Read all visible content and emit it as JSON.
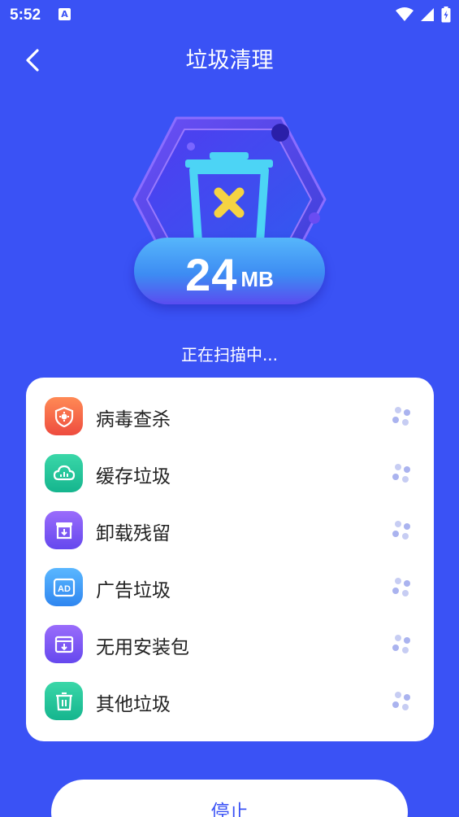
{
  "status_bar": {
    "time": "5:52",
    "notification_badge": "A"
  },
  "header": {
    "title": "垃圾清理"
  },
  "hero": {
    "size_value": "24",
    "size_unit": "MB"
  },
  "scan": {
    "status_text": "正在扫描中..."
  },
  "items": [
    {
      "label": "病毒查杀",
      "icon": "virus-shield-icon",
      "color": "#f2624a"
    },
    {
      "label": "缓存垃圾",
      "icon": "cloud-cache-icon",
      "color": "#22c39a"
    },
    {
      "label": "卸载残留",
      "icon": "uninstall-residue-icon",
      "color": "#7b5cf3"
    },
    {
      "label": "广告垃圾",
      "icon": "ad-icon",
      "color": "#3b9cf7"
    },
    {
      "label": "无用安装包",
      "icon": "package-icon",
      "color": "#7b5cf3"
    },
    {
      "label": "其他垃圾",
      "icon": "trash-icon",
      "color": "#22c39a"
    }
  ],
  "footer": {
    "stop_label": "停止"
  },
  "colors": {
    "background": "#3a52f5",
    "card": "#ffffff",
    "accent": "#3a52f5"
  }
}
